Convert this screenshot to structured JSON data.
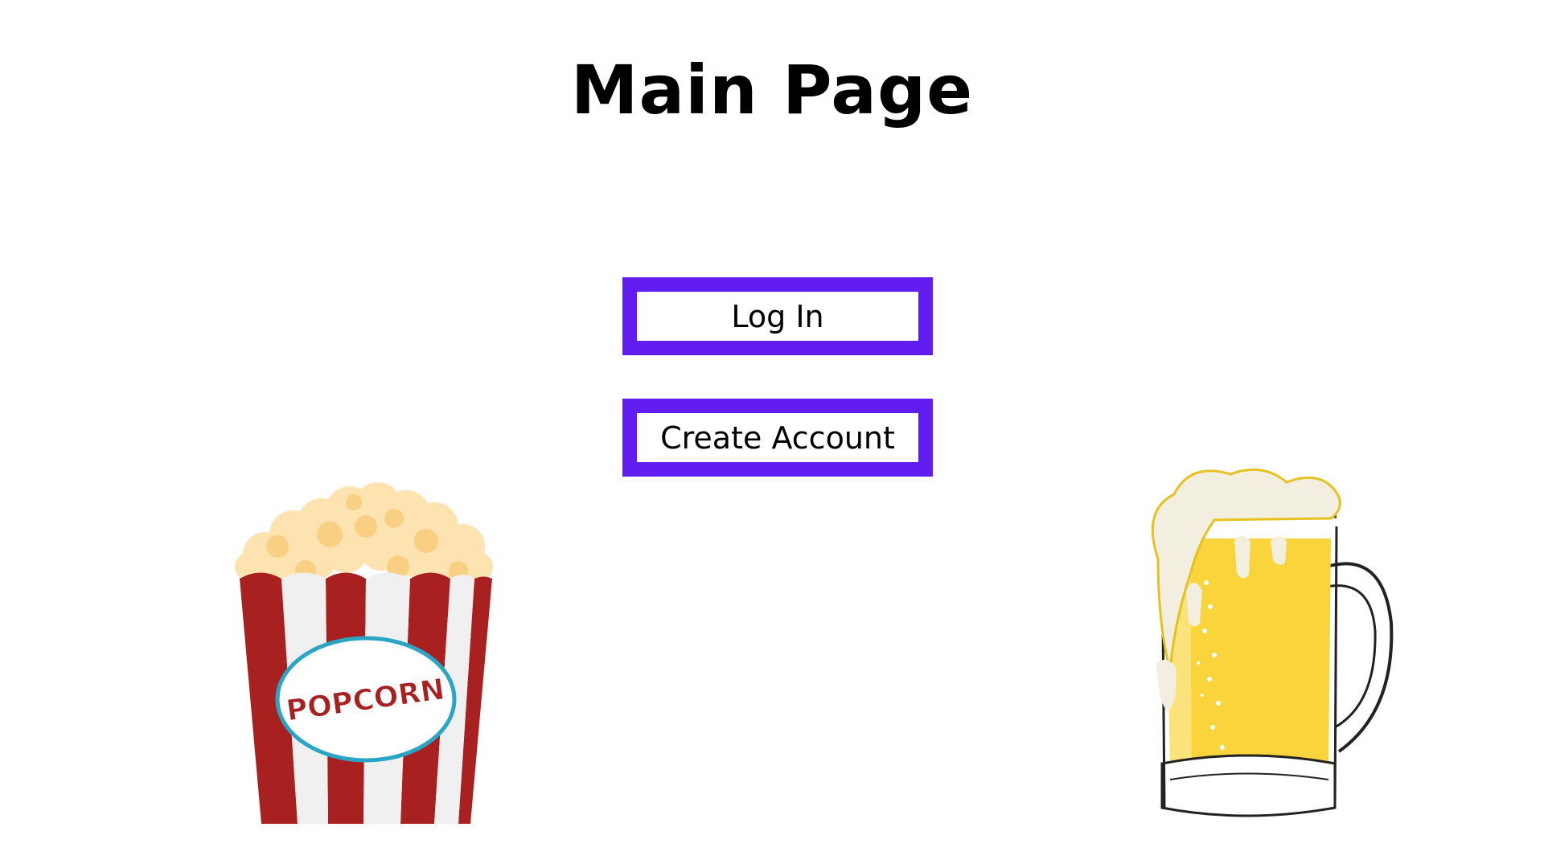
{
  "page": {
    "title": "Main Page"
  },
  "actions": {
    "login_label": "Log In",
    "create_account_label": "Create Account"
  },
  "illustrations": {
    "popcorn_text": "POPCORN",
    "popcorn_icon": "popcorn-bucket-icon",
    "beer_icon": "beer-mug-icon"
  },
  "colors": {
    "accent": "#611cf0",
    "popcorn_red": "#a82020",
    "beer_yellow": "#f9d53b"
  }
}
